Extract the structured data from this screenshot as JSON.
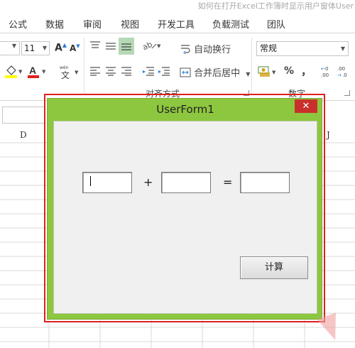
{
  "document_title": "如何在打开Excel工作簿时显示用户窗体User",
  "ribbon_tabs": [
    "公式",
    "数据",
    "审阅",
    "视图",
    "开发工具",
    "负载测试",
    "团队"
  ],
  "font": {
    "size_value": "11"
  },
  "alignment": {
    "wrap_text_label": "自动换行",
    "merge_center_label": "合并后居中",
    "group_label": "对齐方式"
  },
  "number": {
    "format_value": "常规",
    "percent_glyph": "%",
    "comma_glyph": "，",
    "group_label": "数字"
  },
  "sheet": {
    "column_letters": [
      "D",
      "J"
    ]
  },
  "userform": {
    "title": "UserForm1",
    "close_glyph": "✕",
    "plus_label": "+",
    "equals_label": "=",
    "textbox1_value": "",
    "textbox2_value": "",
    "textbox3_value": "",
    "calc_button_label": "计算"
  },
  "colors": {
    "form_frame": "#8dc63f",
    "close_button": "#c9302c",
    "selection_outline": "#e02020"
  }
}
